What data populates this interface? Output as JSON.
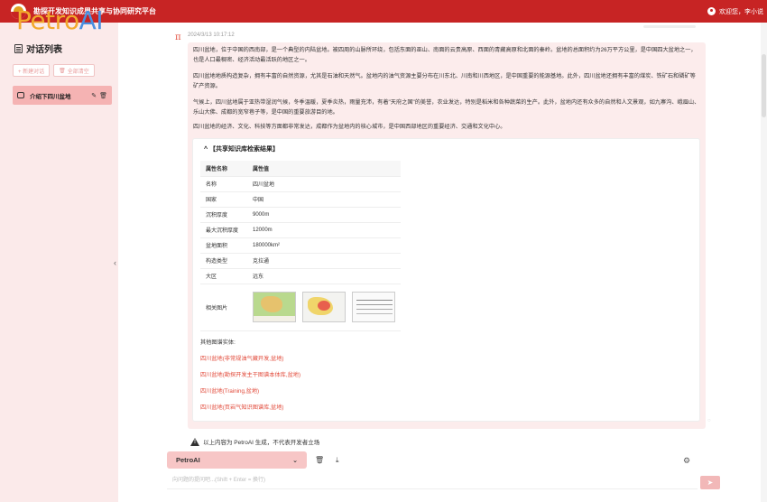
{
  "header": {
    "title": "勘探开发知识成果共享与协同研究平台",
    "user": "欢迎您，李小说"
  },
  "sidebar": {
    "brand_part1": "Petro",
    "brand_part2": "AI",
    "list_title": "对话列表",
    "new_chat": "+ 新建对话",
    "clear_all": "全部清空",
    "conversations": [
      {
        "label": "介绍下四川盆地"
      }
    ]
  },
  "message": {
    "avatar": "π",
    "timestamp": "2024/3/13 10:17:12",
    "paragraphs": [
      "四川盆地，位于中国的西南部，是一个典型的内陆盆地。被四周的山脉所环绕，包括东面的巫山、南面的云贵高原、西面的青藏高原和北面的秦岭。盆地的总面积约为26万平方公里，是中国四大盆地之一，也是人口最稠密、经济活动最活跃的地区之一。",
      "四川盆地地质构造复杂，拥有丰富的自然资源，尤其是石油和天然气。盆地内的油气资源主要分布在川东北、川南和川西地区，是中国重要的能源基地。此外，四川盆地还拥有丰富的煤炭、铁矿石和磷矿等矿产资源。",
      "气候上，四川盆地属于亚热带湿润气候，冬季温暖，夏季炎热，雨量充沛，有着\"天府之国\"的美誉，农业发达，特别是稻米和各种蔬菜的生产。此外，盆地内还有众多的自然和人文景观，如九寨沟、峨眉山、乐山大佛、成都的宽窄巷子等，是中国的重要旅游目的地。",
      "四川盆地的经济、文化、科技等方面都非常发达，成都作为盆地内的核心城市，是中国西部地区的重要经济、交通和文化中心。"
    ],
    "kb": {
      "title": "^ 【共享知识库检索结果】",
      "header_key": "属性名称",
      "header_val": "属性值",
      "rows": [
        {
          "k": "名称",
          "v": "四川盆地"
        },
        {
          "k": "国家",
          "v": "中国"
        },
        {
          "k": "沉积厚度",
          "v": "9000m"
        },
        {
          "k": "最大沉积厚度",
          "v": "12000m"
        },
        {
          "k": "盆地面积",
          "v": "180000km²"
        },
        {
          "k": "构造类型",
          "v": "克拉通"
        },
        {
          "k": "大区",
          "v": "远东"
        }
      ],
      "image_key": "相关图片",
      "other_label": "其他图谱实体:",
      "entities": [
        "四川盆地(非常规油气藏开发,盆地)",
        "四川盆地(勘探开发主干图谱本体库,盆地)",
        "四川盆地(Training,盆地)",
        "四川盆地(页岩气知识图谱库,盆地)"
      ]
    }
  },
  "disclaimer": "以上内容为 PetroAI 生成，不代表开发者立场",
  "input": {
    "model": "PetroAI",
    "placeholder": "向问题的提问吧...(Shift + Enter = 换行)"
  }
}
